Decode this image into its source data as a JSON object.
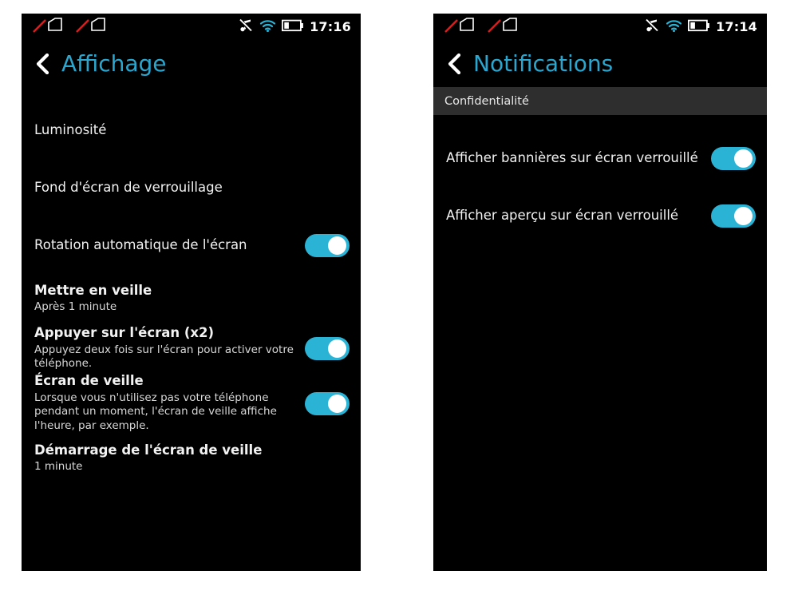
{
  "colors": {
    "accent": "#2BA6CE",
    "toggle_on": "#2BB3D6",
    "screen_bg": "#000000",
    "section_band": "#2e2e2e",
    "page_bg": "#ffffff",
    "sim_slash": "#cc2222",
    "wifi": "#2BB3D6"
  },
  "screens": [
    {
      "id": "display-settings",
      "status_bar": {
        "icons_left": [
          "sim-no-signal-icon",
          "sim-no-signal-icon"
        ],
        "icons_right": [
          "music-muted-icon",
          "wifi-icon",
          "battery-icon"
        ],
        "battery_level_percent": 33,
        "time": "17:16"
      },
      "title": "Affichage",
      "back_label": "back-chevron",
      "section_header": null,
      "rows": [
        {
          "title": "Luminosité",
          "subtitle": null,
          "toggle": null,
          "spacing": "lg"
        },
        {
          "title": "Fond d'écran de verrouillage",
          "subtitle": null,
          "toggle": null,
          "spacing": "lg"
        },
        {
          "title": "Rotation automatique de l'écran",
          "subtitle": null,
          "toggle": "on",
          "spacing": "lg"
        },
        {
          "title": "Mettre en veille",
          "subtitle": "Après 1 minute",
          "toggle": null,
          "spacing": "md"
        },
        {
          "title": "Appuyer sur l'écran (x2)",
          "subtitle": "Appuyez deux fois sur l'écran pour activer votre téléphone.",
          "toggle": "on",
          "spacing": "md"
        },
        {
          "title": "Écran de veille",
          "subtitle": "Lorsque vous n'utilisez pas votre téléphone pendant un moment, l'écran de veille affiche l'heure, par exemple.",
          "toggle": "on",
          "spacing": "md"
        },
        {
          "title": "Démarrage de l'écran de veille",
          "subtitle": "1 minute",
          "toggle": null,
          "spacing": "md"
        }
      ]
    },
    {
      "id": "notification-settings",
      "status_bar": {
        "icons_left": [
          "sim-no-signal-icon",
          "sim-no-signal-icon"
        ],
        "icons_right": [
          "music-muted-icon",
          "wifi-icon",
          "battery-icon"
        ],
        "battery_level_percent": 33,
        "time": "17:14"
      },
      "title": "Notifications",
      "back_label": "back-chevron",
      "section_header": "Confidentialité",
      "rows": [
        {
          "title": "Afficher bannières sur écran verrouillé",
          "subtitle": null,
          "toggle": "on",
          "spacing": "lg"
        },
        {
          "title": "Afficher aperçu sur écran verrouillé",
          "subtitle": null,
          "toggle": "on",
          "spacing": "lg"
        }
      ]
    }
  ]
}
